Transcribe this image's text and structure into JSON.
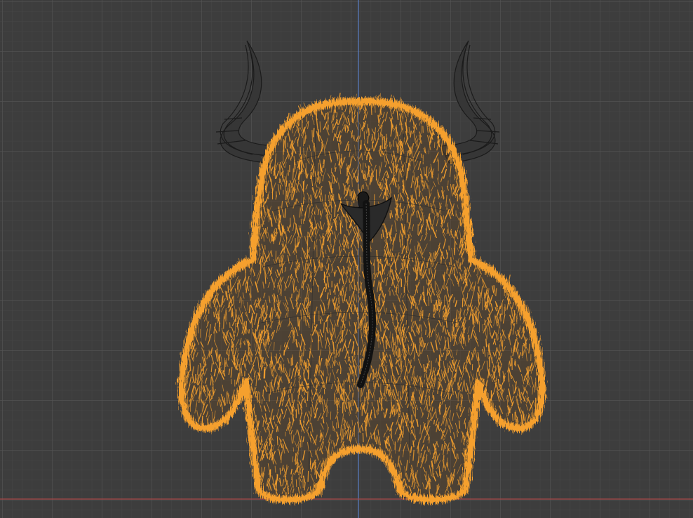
{
  "viewport": {
    "background": "#3d3d3d",
    "grid_minor_color": "#474747",
    "grid_major_color": "#525252",
    "axis_z_color": "#5b7fc4",
    "axis_x_color": "#a84a4a",
    "shading": "wireframe"
  },
  "object": {
    "selected_color": "#f5a02e",
    "wire_color": "#1a1a1a",
    "parts": [
      "body-fur",
      "left-horn",
      "right-horn",
      "mouth",
      "tongue",
      "left-arm",
      "right-arm",
      "left-leg",
      "right-leg"
    ]
  }
}
